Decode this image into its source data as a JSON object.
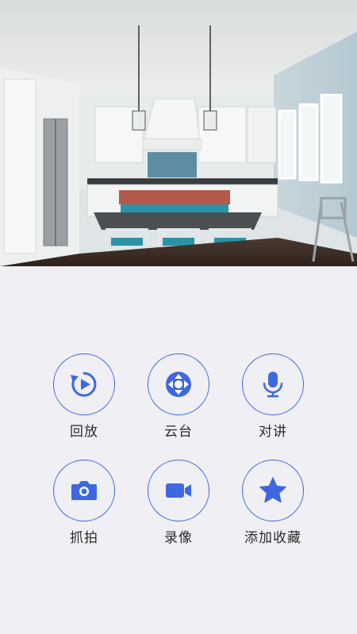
{
  "camera": {
    "feed_description": "kitchen-live-view"
  },
  "colors": {
    "accent": "#3d68e0",
    "background": "#f0eff4",
    "label": "#2b2b2b"
  },
  "controls": {
    "playback": {
      "label": "回放",
      "icon": "playback-icon"
    },
    "ptz": {
      "label": "云台",
      "icon": "ptz-direction-icon"
    },
    "talk": {
      "label": "对讲",
      "icon": "microphone-icon"
    },
    "snapshot": {
      "label": "抓拍",
      "icon": "camera-icon"
    },
    "record": {
      "label": "录像",
      "icon": "video-icon"
    },
    "favorite": {
      "label": "添加收藏",
      "icon": "star-icon"
    }
  }
}
